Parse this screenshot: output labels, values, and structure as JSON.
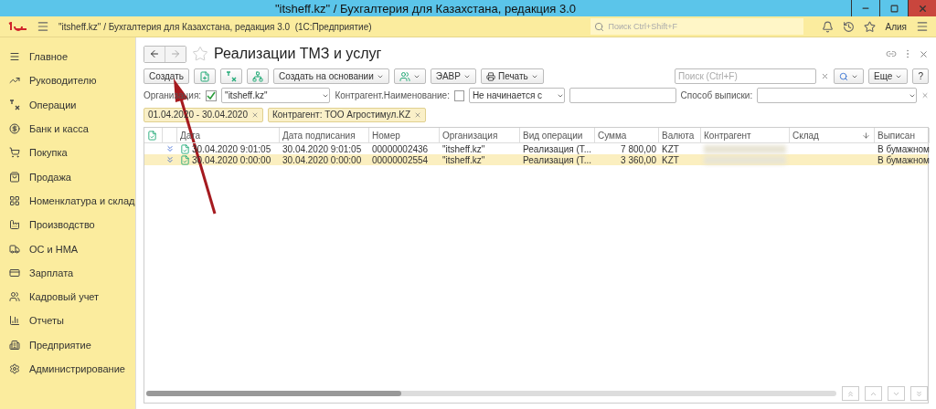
{
  "window": {
    "title": "\"itsheff.kz\" / Бухгалтерия для Казахстана, редакция 3.0"
  },
  "header": {
    "app_title": "\"itsheff.kz\" / Бухгалтерия для Казахстана, редакция 3.0  (1С:Предприятие)",
    "search": {
      "placeholder": "Поиск Ctrl+Shift+F"
    },
    "user": "Алия"
  },
  "sidebar": {
    "items": [
      {
        "label": "Главное"
      },
      {
        "label": "Руководителю"
      },
      {
        "label": "Операции"
      },
      {
        "label": "Банк и касса"
      },
      {
        "label": "Покупка"
      },
      {
        "label": "Продажа"
      },
      {
        "label": "Номенклатура и склад"
      },
      {
        "label": "Производство"
      },
      {
        "label": "ОС и НМА"
      },
      {
        "label": "Зарплата"
      },
      {
        "label": "Кадровый учет"
      },
      {
        "label": "Отчеты"
      },
      {
        "label": "Предприятие"
      },
      {
        "label": "Администрирование"
      }
    ]
  },
  "form": {
    "title": "Реализации ТМЗ и услуг",
    "toolbar": [
      {
        "kind": "text",
        "label": "Создать"
      },
      {
        "kind": "icon"
      },
      {
        "kind": "icon"
      },
      {
        "kind": "icon"
      },
      {
        "kind": "menu",
        "label": "Создать на основании"
      },
      {
        "kind": "iconmenu"
      },
      {
        "kind": "menu",
        "label": "ЭАВР"
      },
      {
        "kind": "printmenu",
        "label": "Печать"
      }
    ],
    "search": {
      "placeholder": "Поиск (Ctrl+F)"
    },
    "more": "Еще",
    "help": "?",
    "filters": {
      "organization": {
        "label": "Организация:",
        "checked": true,
        "value": "\"itsheff.kz\""
      },
      "counterparty": {
        "label": "Контрагент.Наименование:",
        "checked": false,
        "condition": "Не начинается с"
      },
      "method": {
        "label": "Способ выписки:"
      }
    },
    "tags": [
      "01.04.2020 - 30.04.2020",
      "Контрагент: ТОО Агростимул.KZ"
    ],
    "table": {
      "columns": [
        "Дата",
        "Дата подписания",
        "Номер",
        "Организация",
        "Вид операции",
        "Сумма",
        "Валюта",
        "Контрагент",
        "Склад",
        "Выписан"
      ],
      "rows": [
        {
          "selected": false,
          "cells": [
            "30.04.2020 9:01:05",
            "30.04.2020 9:01:05",
            "00000002436",
            "\"itsheff.kz\"",
            "Реализация (Т...",
            "7 800,00",
            "KZT",
            "",
            "",
            "В бумажном"
          ]
        },
        {
          "selected": true,
          "cells": [
            "30.04.2020 0:00:00",
            "30.04.2020 0:00:00",
            "00000002554",
            "\"itsheff.kz\"",
            "Реализация (Т...",
            "3 360,00",
            "KZT",
            "",
            "",
            "В бумажном"
          ]
        }
      ]
    }
  }
}
